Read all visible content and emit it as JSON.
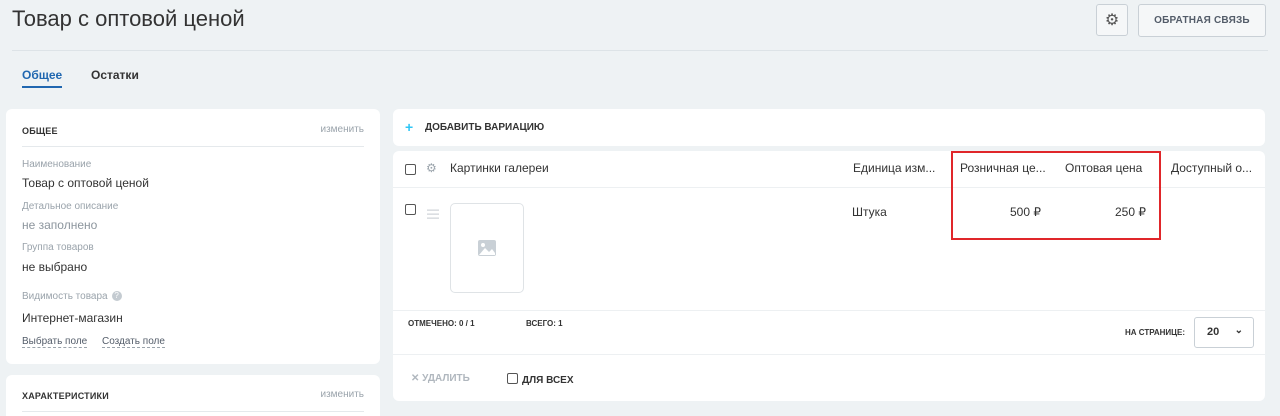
{
  "header": {
    "title": "Товар с оптовой ценой",
    "settings_icon": "gear-icon",
    "feedback_label": "ОБРАТНАЯ СВЯЗЬ"
  },
  "tabs": [
    {
      "label": "Общее",
      "active": true
    },
    {
      "label": "Остатки",
      "active": false
    }
  ],
  "general": {
    "heading": "ОБЩЕЕ",
    "edit": "изменить",
    "fields": [
      {
        "label": "Наименование",
        "value": "Товар с оптовой ценой"
      },
      {
        "label": "Детальное описание",
        "value": "не заполнено"
      },
      {
        "label": "Группа товаров",
        "value": "не выбрано"
      },
      {
        "label": "Видимость товара",
        "value": "Интернет-магазин"
      }
    ],
    "select_field": "Выбрать поле",
    "create_field": "Создать поле"
  },
  "characteristics": {
    "heading": "ХАРАКТЕРИСТИКИ",
    "edit": "изменить"
  },
  "variations": {
    "add_label": "ДОБАВИТЬ ВАРИАЦИЮ",
    "columns": [
      "Картинки галереи",
      "Единица изм...",
      "Розничная це...",
      "Оптовая цена",
      "Доступный о..."
    ],
    "rows": [
      {
        "unit": "Штука",
        "retail_price": "500 ₽",
        "wholesale_price": "250 ₽"
      }
    ],
    "selected_label": "ОТМЕЧЕНО:",
    "selected_value": "0 / 1",
    "total_label": "ВСЕГО:",
    "total_value": "1",
    "per_page_label": "НА СТРАНИЦЕ:",
    "per_page_value": "20",
    "remove_label": "УДАЛИТЬ",
    "for_all_label": "ДЛЯ ВСЕХ"
  },
  "colors": {
    "accent": "#2067b0",
    "plus": "#2fc6f6",
    "highlight": "#e0262a"
  }
}
